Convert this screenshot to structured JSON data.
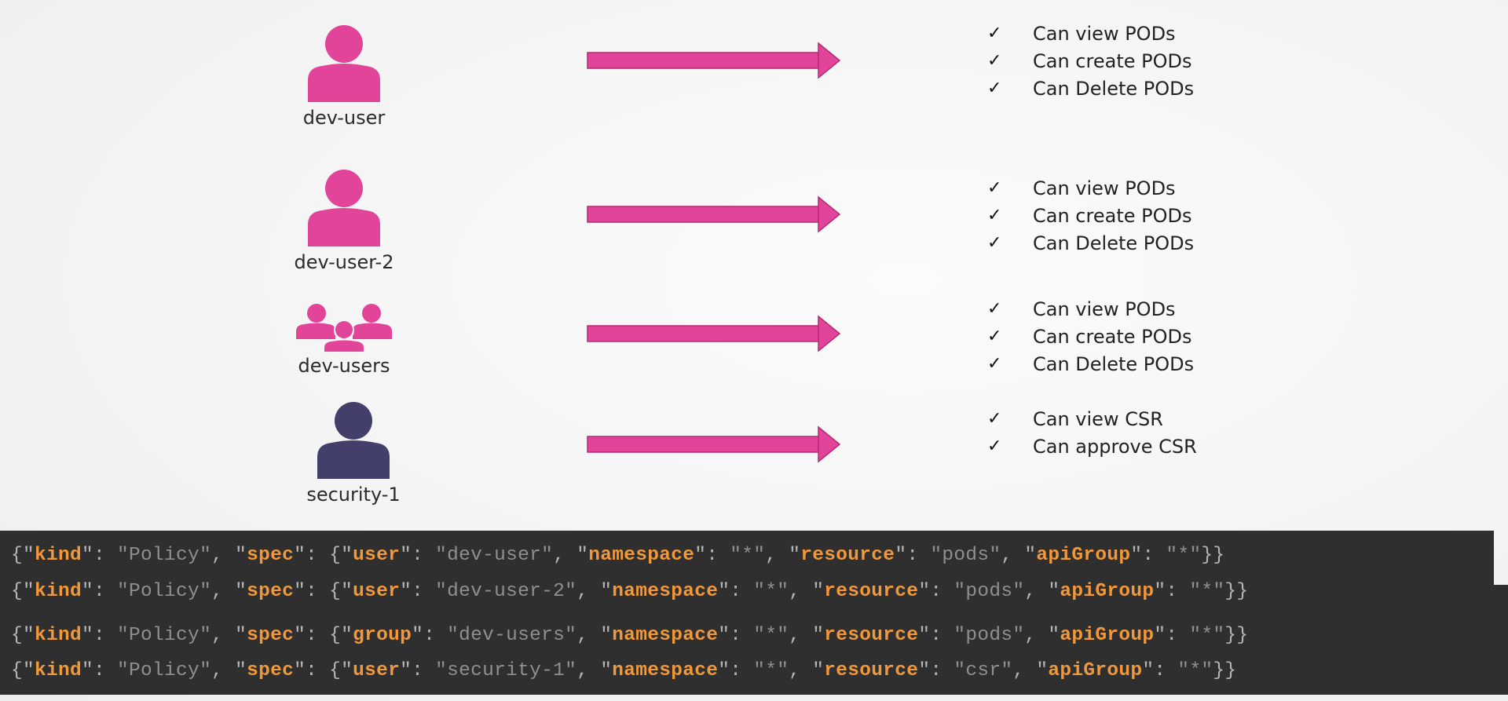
{
  "colors": {
    "accent_pink": "#e2449a",
    "dark_user": "#423f6b",
    "code_bg": "#2f2f2f",
    "code_key": "#f0983a",
    "code_value": "#8f8f8f"
  },
  "subjects": [
    {
      "name": "dev-user",
      "icon": "user-icon",
      "color": "#e2449a"
    },
    {
      "name": "dev-user-2",
      "icon": "user-icon",
      "color": "#e2449a"
    },
    {
      "name": "dev-users",
      "icon": "user-group-icon",
      "color": "#e2449a"
    },
    {
      "name": "security-1",
      "icon": "user-icon",
      "color": "#423f6b"
    }
  ],
  "permissions": [
    {
      "items": [
        "Can view PODs",
        "Can create PODs",
        "Can Delete PODs"
      ]
    },
    {
      "items": [
        "Can view PODs",
        "Can create PODs",
        "Can Delete PODs"
      ]
    },
    {
      "items": [
        "Can view PODs",
        "Can create PODs",
        "Can Delete PODs"
      ]
    },
    {
      "items": [
        "Can view CSR",
        "Can approve CSR"
      ]
    }
  ],
  "check_glyph": "✓",
  "policies": [
    {
      "kind": "Policy",
      "subject_key": "user",
      "subject": "dev-user",
      "namespace": "*",
      "resource": "pods",
      "apiGroup": "*"
    },
    {
      "kind": "Policy",
      "subject_key": "user",
      "subject": "dev-user-2",
      "namespace": "*",
      "resource": "pods",
      "apiGroup": "*"
    },
    {
      "kind": "Policy",
      "subject_key": "group",
      "subject": "dev-users",
      "namespace": "*",
      "resource": "pods",
      "apiGroup": "*"
    },
    {
      "kind": "Policy",
      "subject_key": "user",
      "subject": "security-1",
      "namespace": "*",
      "resource": "csr",
      "apiGroup": "*"
    }
  ]
}
